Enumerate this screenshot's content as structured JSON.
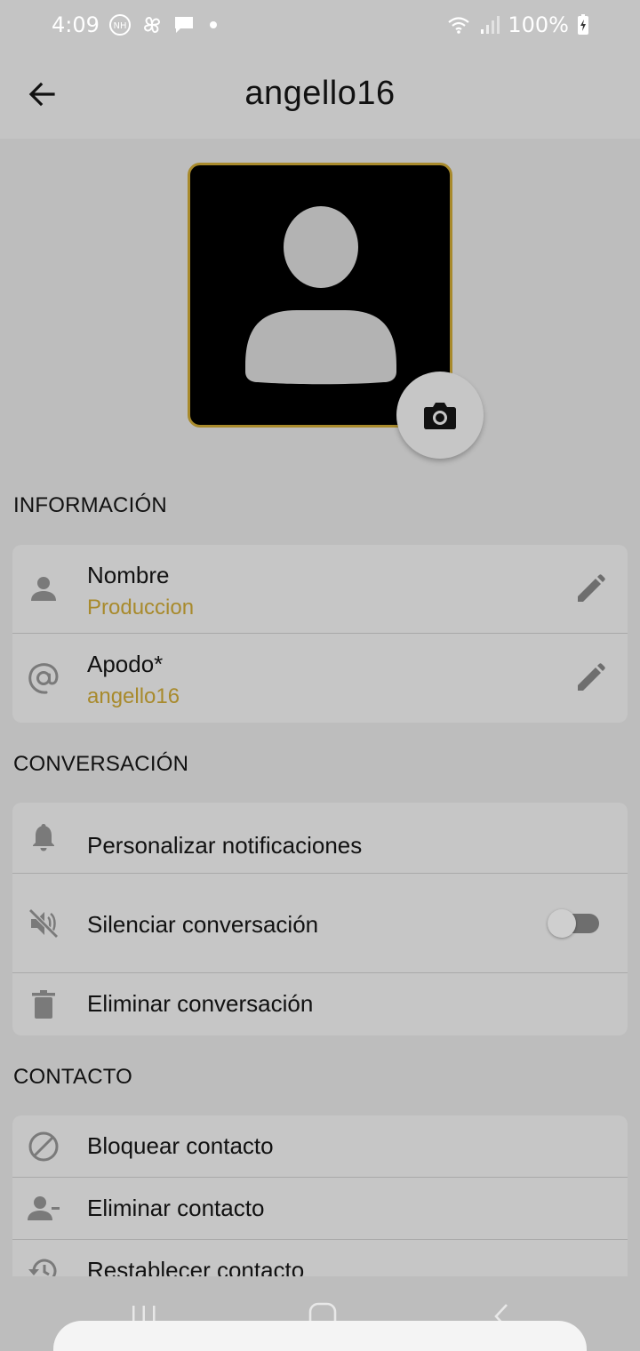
{
  "status_bar": {
    "time": "4:09",
    "battery": "100%",
    "icons": [
      "nh-icon",
      "pinwheel-icon",
      "message-icon",
      "dot-icon",
      "wifi-icon",
      "signal-icon",
      "battery-charging-icon"
    ]
  },
  "app_bar": {
    "title": "angello16",
    "back_icon": "arrow-left-icon"
  },
  "avatar": {
    "icon": "person-silhouette-icon",
    "camera_icon": "camera-icon"
  },
  "sections": {
    "info": {
      "title": "INFORMACIÓN",
      "rows": [
        {
          "icon": "person-icon",
          "label": "Nombre",
          "value": "Produccion",
          "action_icon": "pencil-icon"
        },
        {
          "icon": "at-icon",
          "label": "Apodo*",
          "value": "angello16",
          "action_icon": "pencil-icon"
        }
      ]
    },
    "conversation": {
      "title": "CONVERSACIÓN",
      "rows": [
        {
          "icon": "bell-icon",
          "label": "Personalizar notificaciones"
        },
        {
          "icon": "volume-off-icon",
          "label": "Silenciar conversación",
          "toggle_on": false
        },
        {
          "icon": "trash-icon",
          "label": "Eliminar conversación"
        }
      ]
    },
    "contact": {
      "title": "CONTACTO",
      "rows": [
        {
          "icon": "block-icon",
          "label": "Bloquear contacto"
        },
        {
          "icon": "person-remove-icon",
          "label": "Eliminar contacto"
        },
        {
          "icon": "restore-icon",
          "label": "Restablecer contacto"
        }
      ]
    }
  },
  "colors": {
    "background": "#bdbdbd",
    "card": "#c6c6c6",
    "accent": "#a88a2c",
    "icon": "#7a7a7a"
  },
  "nav_bar": {
    "icons": [
      "recents-icon",
      "home-icon",
      "back-icon"
    ]
  }
}
